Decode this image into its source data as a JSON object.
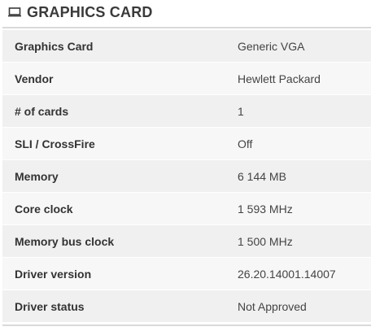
{
  "section": {
    "title": "GRAPHICS CARD",
    "icon": "monitor-icon"
  },
  "rows": [
    {
      "label": "Graphics Card",
      "value": "Generic VGA"
    },
    {
      "label": "Vendor",
      "value": "Hewlett Packard"
    },
    {
      "label": "# of cards",
      "value": "1"
    },
    {
      "label": "SLI / CrossFire",
      "value": "Off"
    },
    {
      "label": "Memory",
      "value": "6 144 MB"
    },
    {
      "label": "Core clock",
      "value": "1 593 MHz"
    },
    {
      "label": "Memory bus clock",
      "value": "1 500 MHz"
    },
    {
      "label": "Driver version",
      "value": "26.20.14001.14007"
    },
    {
      "label": "Driver status",
      "value": "Not Approved"
    }
  ]
}
